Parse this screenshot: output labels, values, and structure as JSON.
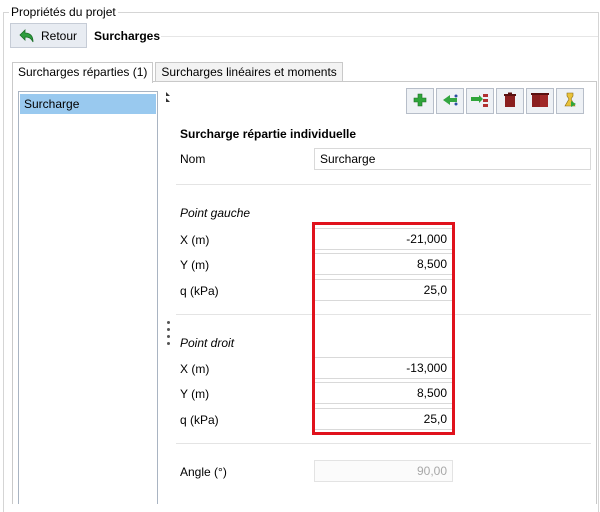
{
  "group": {
    "title": "Propriétés du projet"
  },
  "header": {
    "back_label": "Retour",
    "page_title": "Surcharges"
  },
  "tabs": [
    {
      "label": "Surcharges réparties (1)",
      "active": true
    },
    {
      "label": "Surcharges linéaires et moments",
      "active": false
    }
  ],
  "list": {
    "items": [
      {
        "label": "Surcharge",
        "selected": true
      }
    ]
  },
  "toolbar": {
    "buttons": [
      "add-icon",
      "duplicate-icon",
      "import-icon",
      "delete-icon",
      "delete-all-icon",
      "export-icon"
    ]
  },
  "properties": {
    "section_title": "Surcharge répartie individuelle",
    "name": {
      "label": "Nom",
      "value": "Surcharge"
    },
    "left_point": {
      "title": "Point gauche",
      "x": {
        "label": "X (m)",
        "value": "-21,000"
      },
      "y": {
        "label": "Y (m)",
        "value": "8,500"
      },
      "q": {
        "label": "q (kPa)",
        "value": "25,0"
      }
    },
    "right_point": {
      "title": "Point droit",
      "x": {
        "label": "X (m)",
        "value": "-13,000"
      },
      "y": {
        "label": "Y (m)",
        "value": "8,500"
      },
      "q": {
        "label": "q (kPa)",
        "value": "25,0"
      }
    },
    "angle": {
      "label": "Angle (°)",
      "value": "90,00"
    }
  },
  "colors": {
    "selection": "#99c9ef",
    "highlight": "#e0121c",
    "button_bg": "#e8ecf2"
  }
}
